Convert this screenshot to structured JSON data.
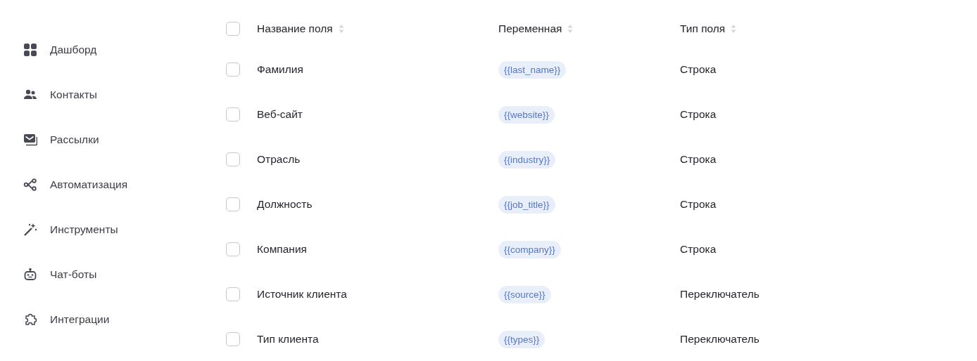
{
  "sidebar": {
    "items": [
      {
        "label": "Дашборд"
      },
      {
        "label": "Контакты"
      },
      {
        "label": "Рассылки"
      },
      {
        "label": "Автоматизация"
      },
      {
        "label": "Инструменты"
      },
      {
        "label": "Чат-боты"
      },
      {
        "label": "Интеграции"
      }
    ]
  },
  "table": {
    "select_all": {
      "checked": false
    },
    "columns": [
      "Название поля",
      "Переменная",
      "Тип поля"
    ],
    "rows": [
      {
        "checked": false,
        "name": "Фамилия",
        "variable": "{{last_name}}",
        "type": "Строка"
      },
      {
        "checked": false,
        "name": "Веб-сайт",
        "variable": "{{website}}",
        "type": "Строка"
      },
      {
        "checked": false,
        "name": "Отрасль",
        "variable": "{{industry}}",
        "type": "Строка"
      },
      {
        "checked": false,
        "name": "Должность",
        "variable": "{{job_title}}",
        "type": "Строка"
      },
      {
        "checked": false,
        "name": "Компания",
        "variable": "{{company}}",
        "type": "Строка"
      },
      {
        "checked": false,
        "name": "Источник клиента",
        "variable": "{{source}}",
        "type": "Переключатель"
      },
      {
        "checked": false,
        "name": "Тип клиента",
        "variable": "{{types}}",
        "type": "Переключатель"
      }
    ]
  }
}
